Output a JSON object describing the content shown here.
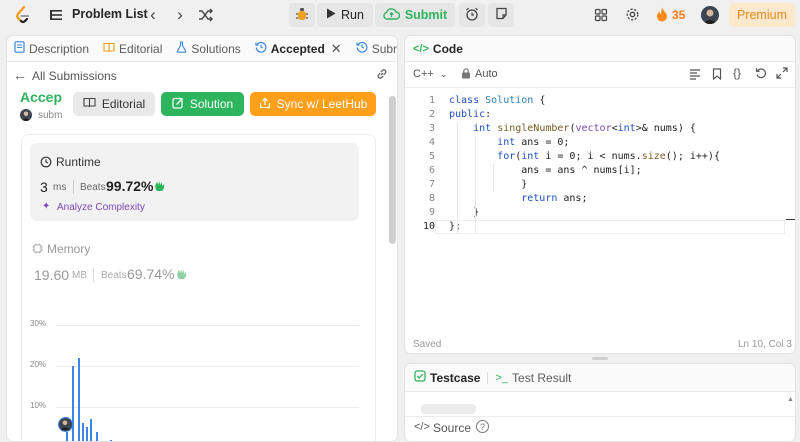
{
  "topbar": {
    "problem_list": "Problem List",
    "run": "Run",
    "submit": "Submit",
    "streak": "35",
    "premium": "Premium"
  },
  "left_tabs": [
    "Description",
    "Editorial",
    "Solutions",
    "Accepted",
    "Submis"
  ],
  "submission": {
    "back": "All Submissions",
    "status": "Accepte",
    "submitted_by": "subm",
    "editorial_btn": "Editorial",
    "solution_btn": "Solution",
    "sync_btn": "Sync w/ LeetHub"
  },
  "runtime": {
    "title": "Runtime",
    "value": "3",
    "unit": "ms",
    "beats_label": "Beats",
    "beats": "99.72%",
    "analyze": "Analyze Complexity"
  },
  "memory": {
    "title": "Memory",
    "value": "19.60",
    "unit": "MB",
    "beats_label": "Beats",
    "beats": "69.74%"
  },
  "chart_data": {
    "type": "bar",
    "y_ticks": [
      "30%",
      "20%",
      "10%"
    ],
    "ylim": [
      0,
      30
    ],
    "values": [
      4,
      20,
      22,
      6,
      5,
      7,
      4,
      1,
      2
    ],
    "grid": true
  },
  "code_panel": {
    "title": "Code",
    "language": "C++",
    "mode": "Auto",
    "saved": "Saved",
    "cursor": "Ln 10, Col 3",
    "lines": [
      "class Solution {",
      "public:",
      "    int singleNumber(vector<int>& nums) {",
      "        int ans = 0;",
      "        for(int i = 0; i < nums.size(); i++){",
      "            ans = ans ^ nums[i];",
      "            }",
      "            return ans;",
      "    }",
      "};"
    ]
  },
  "bottom": {
    "testcase": "Testcase",
    "test_result": "Test Result",
    "source": "Source"
  },
  "colors": {
    "accent_green": "#2db55d",
    "accent_orange": "#ff9f1a",
    "bar_blue": "#3c87e6",
    "premium_bg": "#fce8cc"
  }
}
